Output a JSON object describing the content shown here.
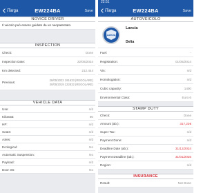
{
  "colors": {
    "brand_blue": "#1d57a6",
    "warning_red": "#e0343c"
  },
  "screen1": {
    "status": {
      "time": "",
      "indicators": ""
    },
    "nav": {
      "back_label": "iTarga",
      "title": "EW224BA",
      "save_label": "Save"
    },
    "novice_driver": {
      "header": "NOVICE DRIVER",
      "text": "Il veicolo può essere guidato da un neopatentato."
    },
    "inspection": {
      "header": "INSPECTION",
      "rows": [
        {
          "label": "Check:",
          "value": "Done"
        },
        {
          "label": "Inspection Date:",
          "value": "22/05/2024"
        },
        {
          "label": "Km detected:",
          "value": "212.444"
        },
        {
          "label": "Previous:",
          "value": "28/05/2022 191633 (REGOLARE)\n30/05/2019 122832 (REGOLARE)"
        }
      ]
    },
    "vehicle_data": {
      "header": "VEHICLE DATA",
      "rows": [
        {
          "label": "Use:",
          "value": "n/d"
        },
        {
          "label": "Kilowatt:",
          "value": "80"
        },
        {
          "label": "HP:",
          "value": "n/d"
        },
        {
          "label": "Seats:",
          "value": "n/d"
        },
        {
          "label": "Axles:",
          "value": "n/d"
        },
        {
          "label": "Ecological:",
          "value": "No"
        },
        {
          "label": "Automatic Suspension:",
          "value": "No"
        },
        {
          "label": "Payload:",
          "value": "n/d"
        },
        {
          "label": "Door 3G:",
          "value": "No"
        }
      ]
    }
  },
  "screen2": {
    "status": {
      "time": "22:51",
      "indicators": ""
    },
    "nav": {
      "back_label": "iTarga",
      "title": "EW224BA",
      "save_label": "Save"
    },
    "autoveicolo": {
      "header": "AUTOVEICOLO",
      "make": "Lancia",
      "model": "Delta",
      "logo_text": "LANCIA"
    },
    "details": [
      {
        "label": "Fuel:",
        "value": "-"
      },
      {
        "label": "Registration:",
        "value": "01/05/2014"
      },
      {
        "label": "Vin:",
        "value": "n/d"
      },
      {
        "label": "Homologation:",
        "value": "n/d"
      },
      {
        "label": "Cubic capacity:",
        "value": "1400"
      },
      {
        "label": "Environmental Class:",
        "value": "Euro 6"
      }
    ],
    "stamp_duty": {
      "header": "STAMP DUTY",
      "rows": [
        {
          "label": "Check:",
          "value": "Done",
          "red": false
        },
        {
          "label": "Amount (ab.):",
          "value": "317,23€",
          "red": true
        },
        {
          "label": "Super Tax:",
          "value": "n/d",
          "red": false
        },
        {
          "label": "Payment Done:",
          "value": "n/d",
          "red": false
        },
        {
          "label": "Deadline Date (ab.):",
          "value": "31/12/2024",
          "red": true
        },
        {
          "label": "Payment Deadline (ab.):",
          "value": "31/01/2025",
          "red": true
        },
        {
          "label": "Region:",
          "value": "n/d",
          "red": false
        }
      ]
    },
    "insurance": {
      "header": "INSURANCE",
      "rows": [
        {
          "label": "Result:",
          "value": "Not Done"
        }
      ]
    }
  }
}
